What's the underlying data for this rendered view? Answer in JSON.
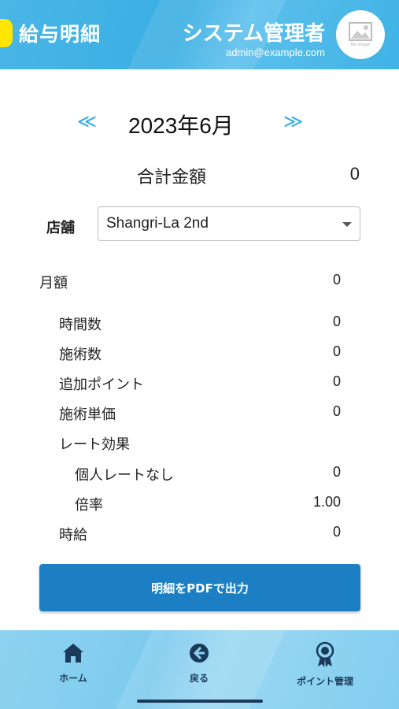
{
  "header": {
    "app_title": "給与明細",
    "user_name": "システム管理者",
    "user_email": "admin@example.com",
    "avatar_placeholder": "No Image"
  },
  "month_nav": {
    "prev_label": "≪",
    "month": "2023年6月",
    "next_label": "≫"
  },
  "total": {
    "label": "合計金額",
    "value": "0"
  },
  "store": {
    "label": "店舗",
    "selected": "Shangri-La 2nd"
  },
  "details": [
    {
      "label": "月額",
      "value": "0"
    },
    {
      "label": "時間数",
      "value": "0"
    },
    {
      "label": "施術数",
      "value": "0"
    },
    {
      "label": "追加ポイント",
      "value": "0"
    },
    {
      "label": "施術単価",
      "value": "0"
    },
    {
      "label": "レート効果",
      "value": ""
    },
    {
      "label": "個人レートなし",
      "value": "0"
    },
    {
      "label": "倍率",
      "value": "1.00"
    },
    {
      "label": "時給",
      "value": "0"
    }
  ],
  "pdf_button": {
    "label": "明細をPDFで出力"
  },
  "bottom_nav": {
    "home": "ホーム",
    "back": "戻る",
    "points": "ポイント管理"
  },
  "colors": {
    "accent": "#3aaee3",
    "button": "#1c7fc4",
    "highlight": "#ffe600"
  }
}
